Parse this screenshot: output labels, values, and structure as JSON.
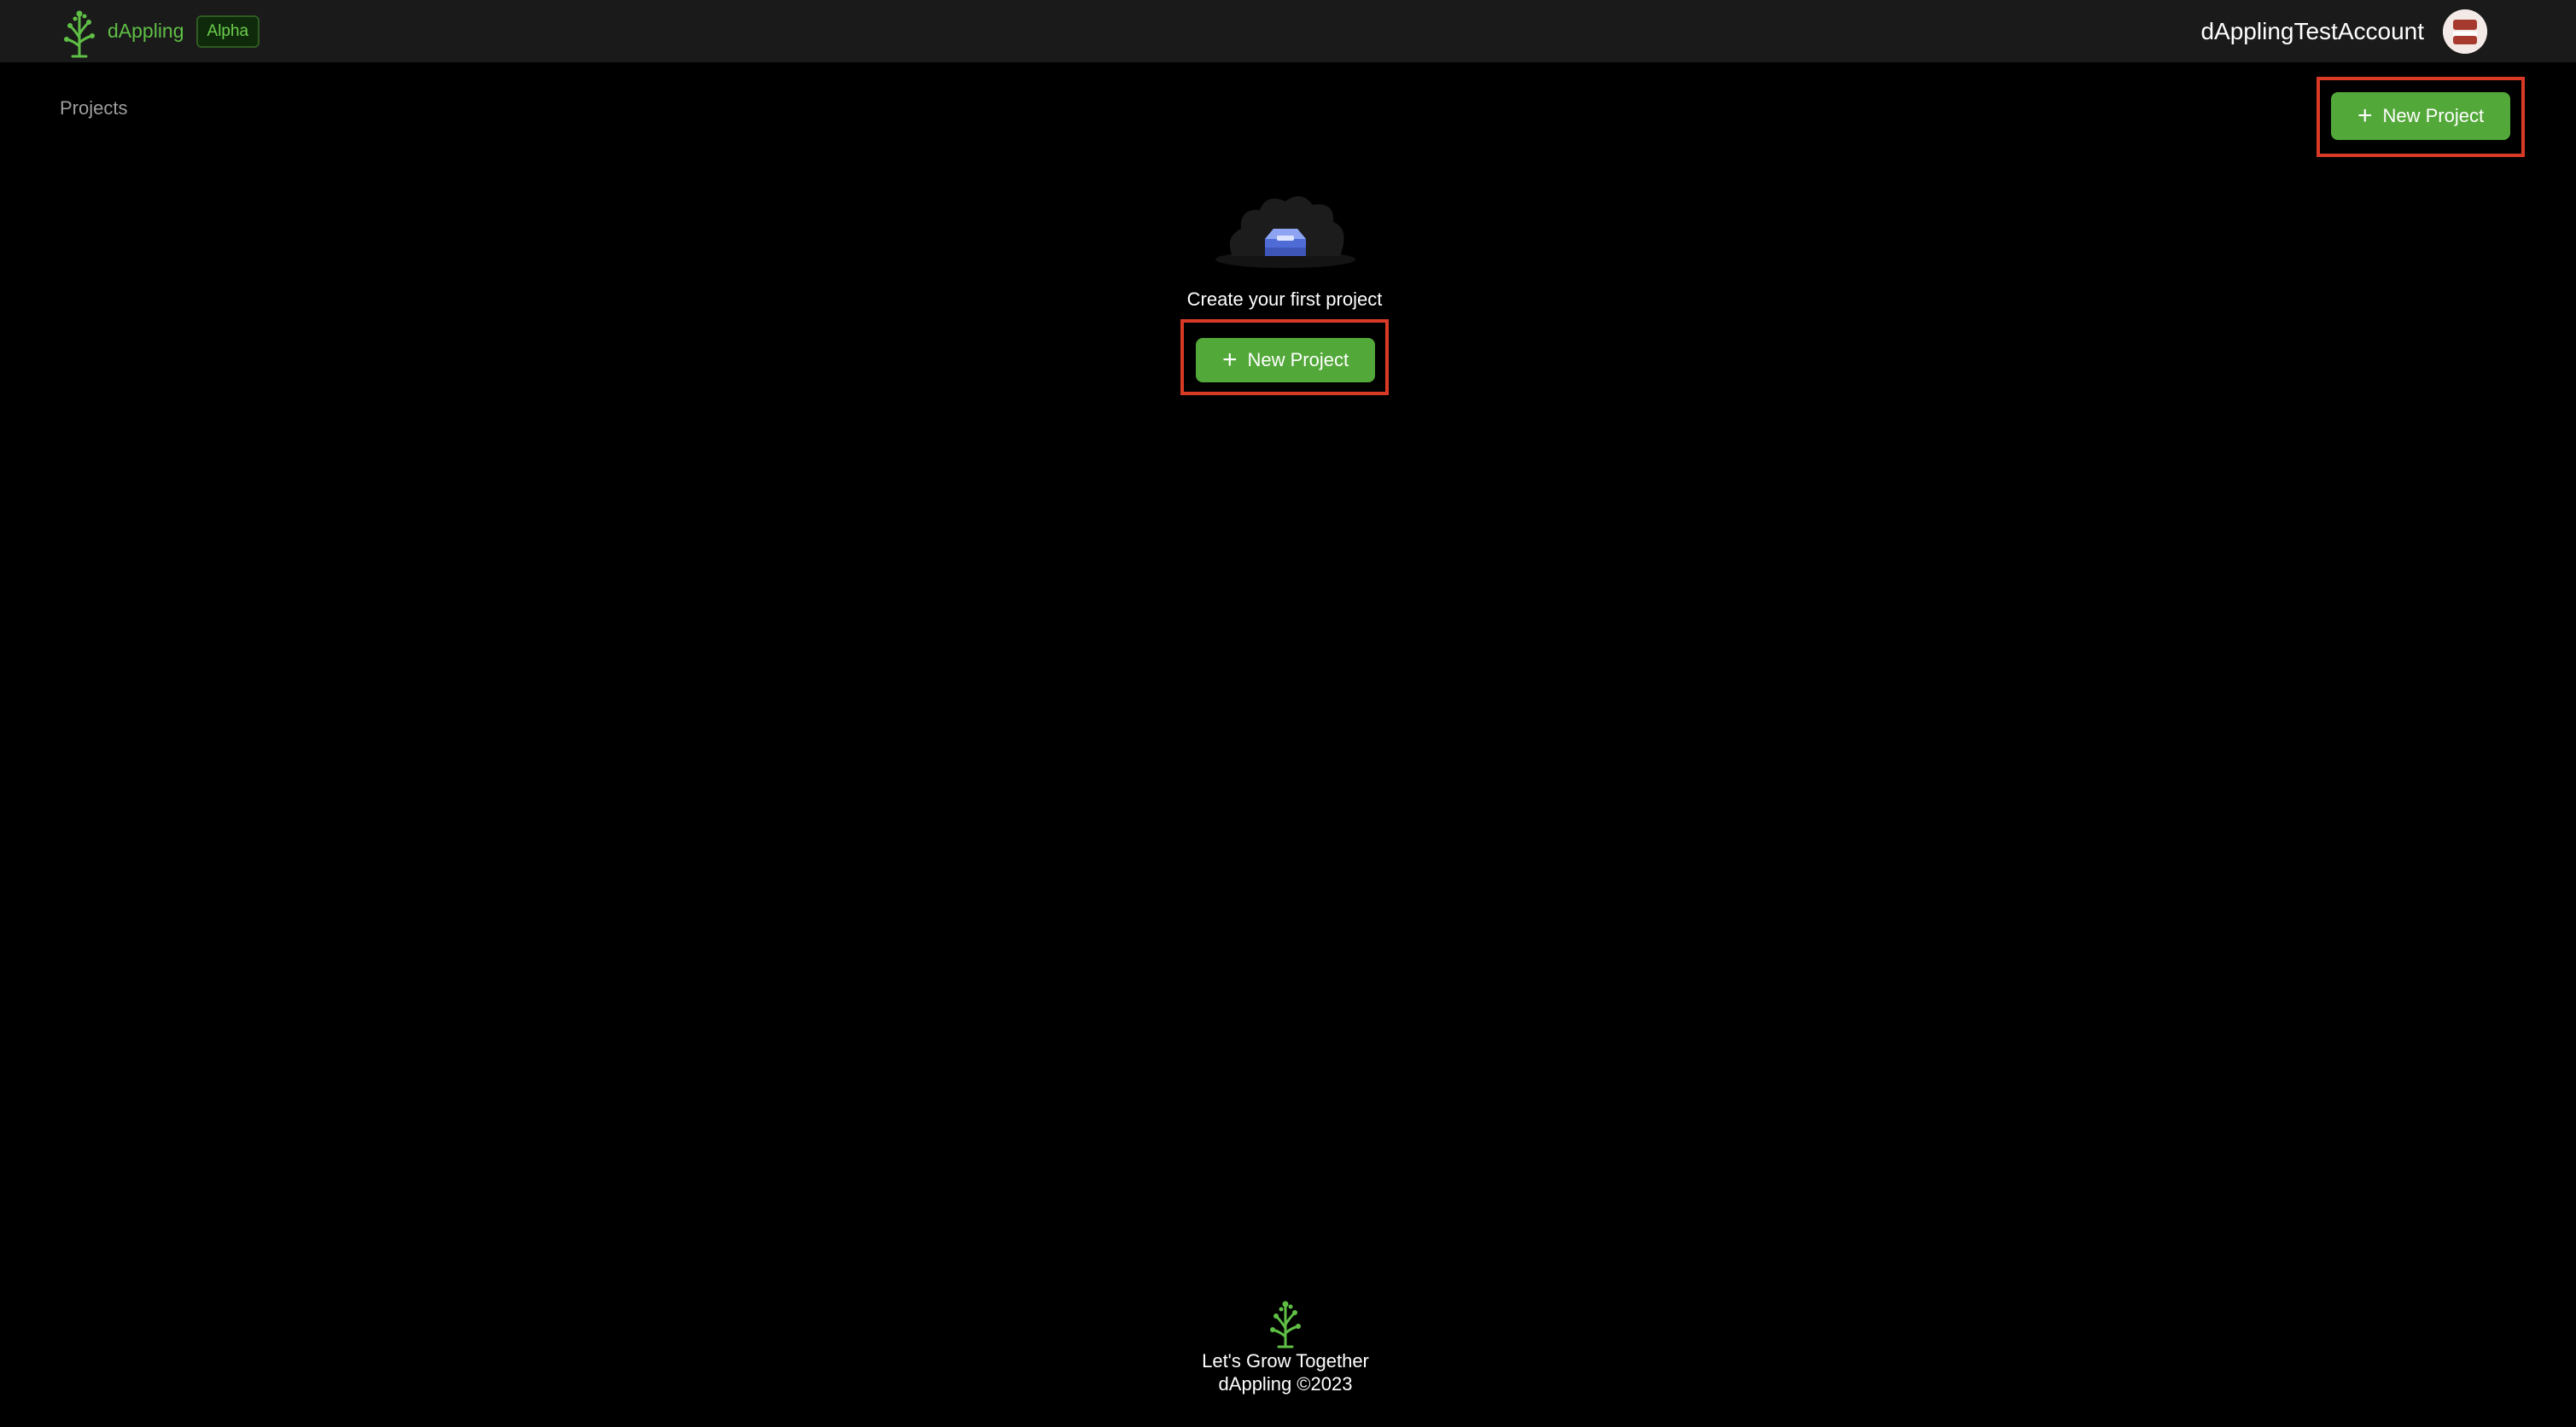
{
  "header": {
    "brand_name": "dAppling",
    "badge": "Alpha",
    "account_name": "dApplingTestAccount",
    "logo_icon": "sapling-logo-icon",
    "avatar_icon": "user-avatar-icon"
  },
  "main": {
    "section_label": "Projects",
    "new_project_label": "New Project",
    "empty_state": {
      "message": "Create your first project",
      "icon": "empty-box-icon",
      "cta_label": "New Project"
    }
  },
  "footer": {
    "tagline": "Let's Grow Together",
    "copyright": "dAppling ©2023"
  },
  "colors": {
    "accent_green": "#53a83a",
    "brand_green": "#5fbf45",
    "highlight_red": "#d93a26",
    "header_bg": "#1a1a1a",
    "page_bg": "#000000"
  }
}
